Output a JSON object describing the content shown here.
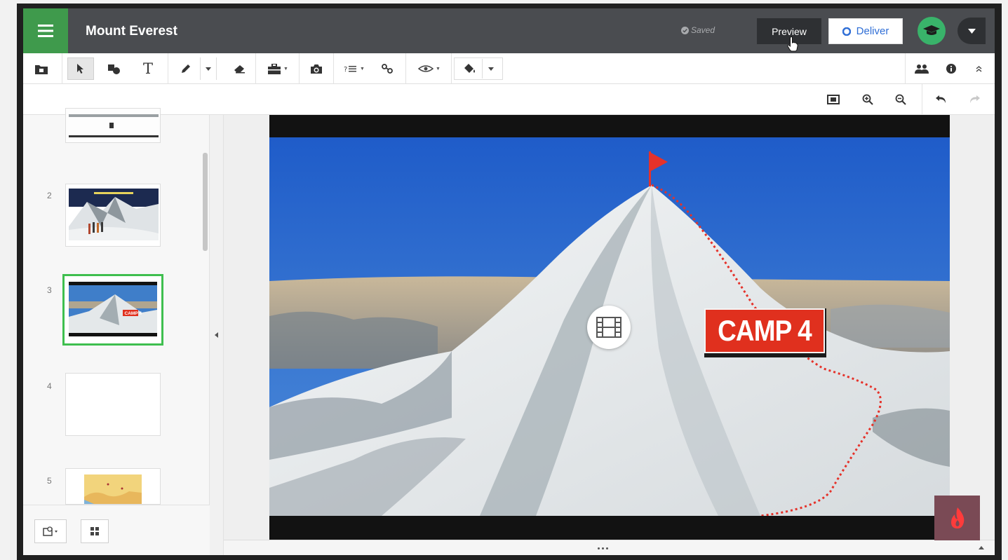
{
  "header": {
    "title": "Mount Everest",
    "saved_label": "Saved",
    "preview_label": "Preview",
    "deliver_label": "Deliver"
  },
  "sidebar": {
    "slides": [
      {
        "number": "2"
      },
      {
        "number": "3",
        "selected": true
      },
      {
        "number": "4"
      },
      {
        "number": "5"
      }
    ]
  },
  "slide": {
    "label": "CAMP 4"
  },
  "colors": {
    "header_bg": "#4a4c50",
    "accent_green": "#3f9a4c",
    "deliver_blue": "#2f6ed6",
    "camp_label_red": "#e0301e",
    "selection_border": "#3fbf4f"
  }
}
